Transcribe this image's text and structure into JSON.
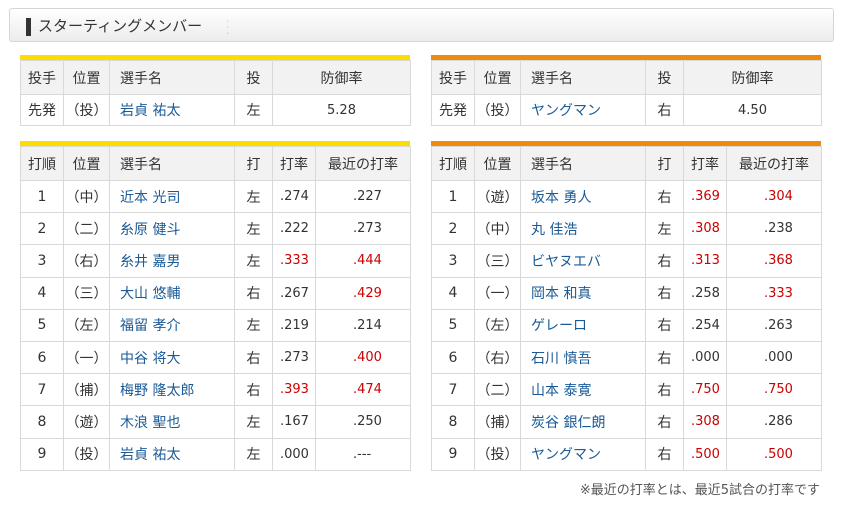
{
  "header": {
    "title": "スターティングメンバー"
  },
  "colors": {
    "home_accent": "#ffdc00",
    "away_accent": "#ee8a0c",
    "name_link": "#1a5a96",
    "highlight": "#cc0000"
  },
  "pitcher_headers": [
    "投手",
    "位置",
    "選手名",
    "投",
    "防御率"
  ],
  "batter_headers": [
    "打順",
    "位置",
    "選手名",
    "打",
    "打率",
    "最近の打率"
  ],
  "home": {
    "pitcher": {
      "role": "先発",
      "pos": "（投）",
      "name": "岩貞 祐太",
      "throws": "左",
      "era": "5.28"
    },
    "lineup": [
      {
        "order": "1",
        "pos": "（中）",
        "name": "近本 光司",
        "bats": "左",
        "avg": ".274",
        "recent": ".227",
        "avg_hl": false,
        "recent_hl": false
      },
      {
        "order": "2",
        "pos": "（二）",
        "name": "糸原 健斗",
        "bats": "左",
        "avg": ".222",
        "recent": ".273",
        "avg_hl": false,
        "recent_hl": false
      },
      {
        "order": "3",
        "pos": "（右）",
        "name": "糸井 嘉男",
        "bats": "左",
        "avg": ".333",
        "recent": ".444",
        "avg_hl": true,
        "recent_hl": true
      },
      {
        "order": "4",
        "pos": "（三）",
        "name": "大山 悠輔",
        "bats": "右",
        "avg": ".267",
        "recent": ".429",
        "avg_hl": false,
        "recent_hl": true
      },
      {
        "order": "5",
        "pos": "（左）",
        "name": "福留 孝介",
        "bats": "左",
        "avg": ".219",
        "recent": ".214",
        "avg_hl": false,
        "recent_hl": false
      },
      {
        "order": "6",
        "pos": "（一）",
        "name": "中谷 将大",
        "bats": "右",
        "avg": ".273",
        "recent": ".400",
        "avg_hl": false,
        "recent_hl": true
      },
      {
        "order": "7",
        "pos": "（捕）",
        "name": "梅野 隆太郎",
        "bats": "右",
        "avg": ".393",
        "recent": ".474",
        "avg_hl": true,
        "recent_hl": true
      },
      {
        "order": "8",
        "pos": "（遊）",
        "name": "木浪 聖也",
        "bats": "左",
        "avg": ".167",
        "recent": ".250",
        "avg_hl": false,
        "recent_hl": false
      },
      {
        "order": "9",
        "pos": "（投）",
        "name": "岩貞 祐太",
        "bats": "左",
        "avg": ".000",
        "recent": ".---",
        "avg_hl": false,
        "recent_hl": false
      }
    ]
  },
  "away": {
    "pitcher": {
      "role": "先発",
      "pos": "（投）",
      "name": "ヤングマン",
      "throws": "右",
      "era": "4.50"
    },
    "lineup": [
      {
        "order": "1",
        "pos": "（遊）",
        "name": "坂本 勇人",
        "bats": "右",
        "avg": ".369",
        "recent": ".304",
        "avg_hl": true,
        "recent_hl": true
      },
      {
        "order": "2",
        "pos": "（中）",
        "name": "丸 佳浩",
        "bats": "左",
        "avg": ".308",
        "recent": ".238",
        "avg_hl": true,
        "recent_hl": false
      },
      {
        "order": "3",
        "pos": "（三）",
        "name": "ビヤヌエバ",
        "bats": "右",
        "avg": ".313",
        "recent": ".368",
        "avg_hl": true,
        "recent_hl": true
      },
      {
        "order": "4",
        "pos": "（一）",
        "name": "岡本 和真",
        "bats": "右",
        "avg": ".258",
        "recent": ".333",
        "avg_hl": false,
        "recent_hl": true
      },
      {
        "order": "5",
        "pos": "（左）",
        "name": "ゲレーロ",
        "bats": "右",
        "avg": ".254",
        "recent": ".263",
        "avg_hl": false,
        "recent_hl": false
      },
      {
        "order": "6",
        "pos": "（右）",
        "name": "石川 慎吾",
        "bats": "右",
        "avg": ".000",
        "recent": ".000",
        "avg_hl": false,
        "recent_hl": false
      },
      {
        "order": "7",
        "pos": "（二）",
        "name": "山本 泰寛",
        "bats": "右",
        "avg": ".750",
        "recent": ".750",
        "avg_hl": true,
        "recent_hl": true
      },
      {
        "order": "8",
        "pos": "（捕）",
        "name": "炭谷 銀仁朗",
        "bats": "右",
        "avg": ".308",
        "recent": ".286",
        "avg_hl": true,
        "recent_hl": false
      },
      {
        "order": "9",
        "pos": "（投）",
        "name": "ヤングマン",
        "bats": "右",
        "avg": ".500",
        "recent": ".500",
        "avg_hl": true,
        "recent_hl": true
      }
    ]
  },
  "footnote": "※最近の打率とは、最近5試合の打率です"
}
